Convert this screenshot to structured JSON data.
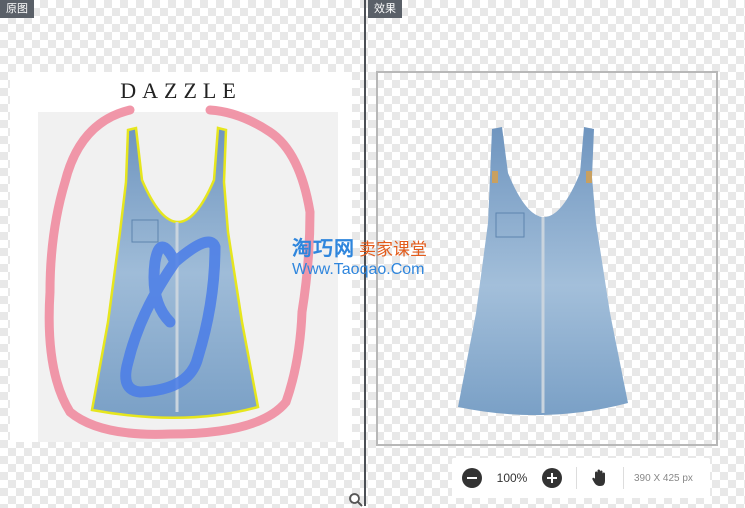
{
  "panes": {
    "left_label": "原图",
    "right_label": "效果"
  },
  "original": {
    "brand": "DAZZLE"
  },
  "watermark": {
    "site": "淘巧网",
    "tagline": "卖家课堂",
    "url": "Www.Taoqao.Com"
  },
  "toolbar": {
    "zoom": "100%",
    "dimensions": "390 X 425 px"
  },
  "colors": {
    "keep_stroke": "#4a7de8",
    "remove_stroke": "#f08ca0",
    "edge_stroke": "#e6e61e",
    "denim": "#7ea4c8"
  },
  "icons": [
    "zoom-out-icon",
    "zoom-in-icon",
    "hand-icon",
    "magnifier-icon"
  ]
}
